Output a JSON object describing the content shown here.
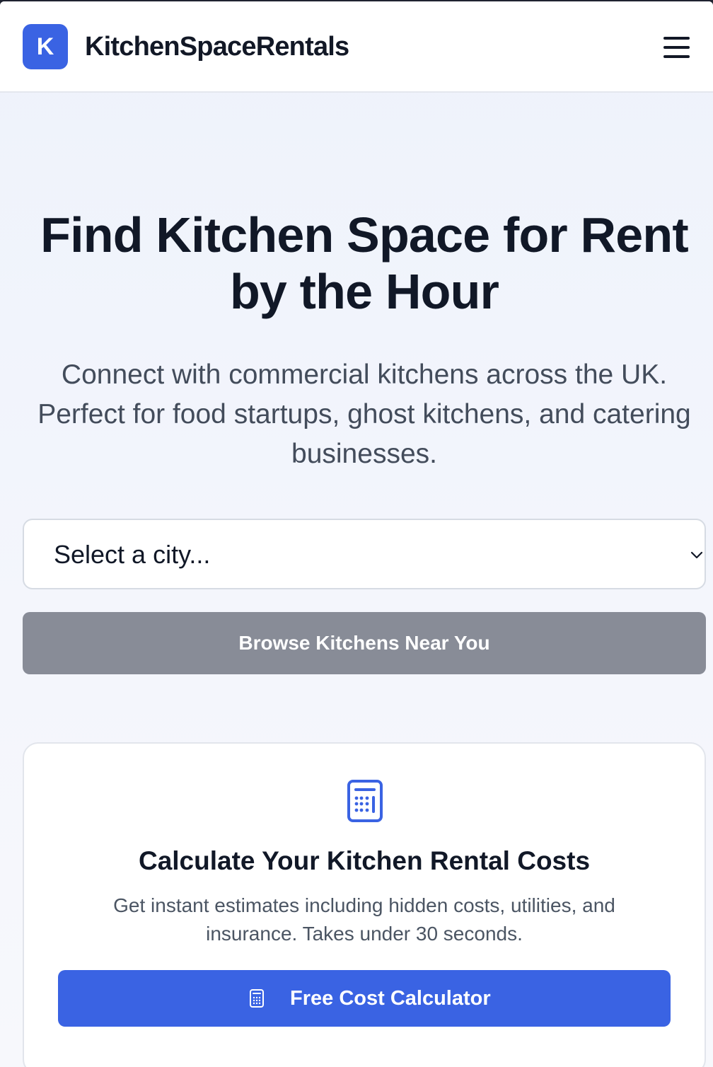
{
  "header": {
    "logo_letter": "K",
    "brand_name": "KitchenSpaceRentals",
    "menu_icon": "hamburger-menu-icon"
  },
  "hero": {
    "title": "Find Kitchen Space for Rent by the Hour",
    "subtitle": "Connect with commercial kitchens across the UK. Perfect for food startups, ghost kitchens, and catering businesses."
  },
  "search": {
    "city_select_value": "Select a city...",
    "browse_button_label": "Browse Kitchens Near You"
  },
  "calculator_card": {
    "icon": "calculator-icon",
    "title": "Calculate Your Kitchen Rental Costs",
    "description": "Get instant estimates including hidden costs, utilities, and insurance. Takes under 30 seconds.",
    "button_label": "Free Cost Calculator",
    "button_icon": "calculator-icon"
  },
  "colors": {
    "brand_blue": "#3a63e3",
    "disabled_button": "#888c97",
    "heading_text": "#111827"
  }
}
